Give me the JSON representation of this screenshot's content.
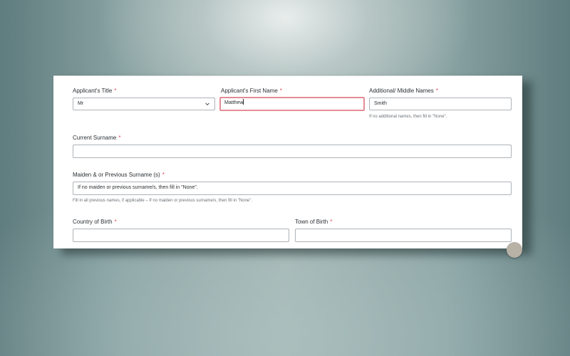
{
  "form": {
    "required_marker": "*",
    "title": {
      "label": "Applicant's Title",
      "value": "Mr"
    },
    "first_name": {
      "label": "Applicant's First Name",
      "value": "Matthew"
    },
    "middle_names": {
      "label": "Additional/ Middle Names",
      "value": "Smith",
      "help": "If no additional names, then fill in \"None\"."
    },
    "current_surname": {
      "label": "Current Surname",
      "value": ""
    },
    "previous_surname": {
      "label": "Maiden & or Previous Surname (s)",
      "value": "If no maiden or previous surname/s, then fill in \"None\".",
      "help": "Fill in all previous names, if applicable – If no maiden or previous surname/s, then fill in \"None\"."
    },
    "country_of_birth": {
      "label": "Country of Birth",
      "value": ""
    },
    "town_of_birth": {
      "label": "Town of Birth",
      "value": ""
    }
  },
  "colors": {
    "required": "#e0455a",
    "focus_border": "#e48c95",
    "input_border": "#aeb3b8"
  },
  "icons": {
    "dropdown": "chevron-down-icon",
    "help": "help-circle-icon"
  }
}
